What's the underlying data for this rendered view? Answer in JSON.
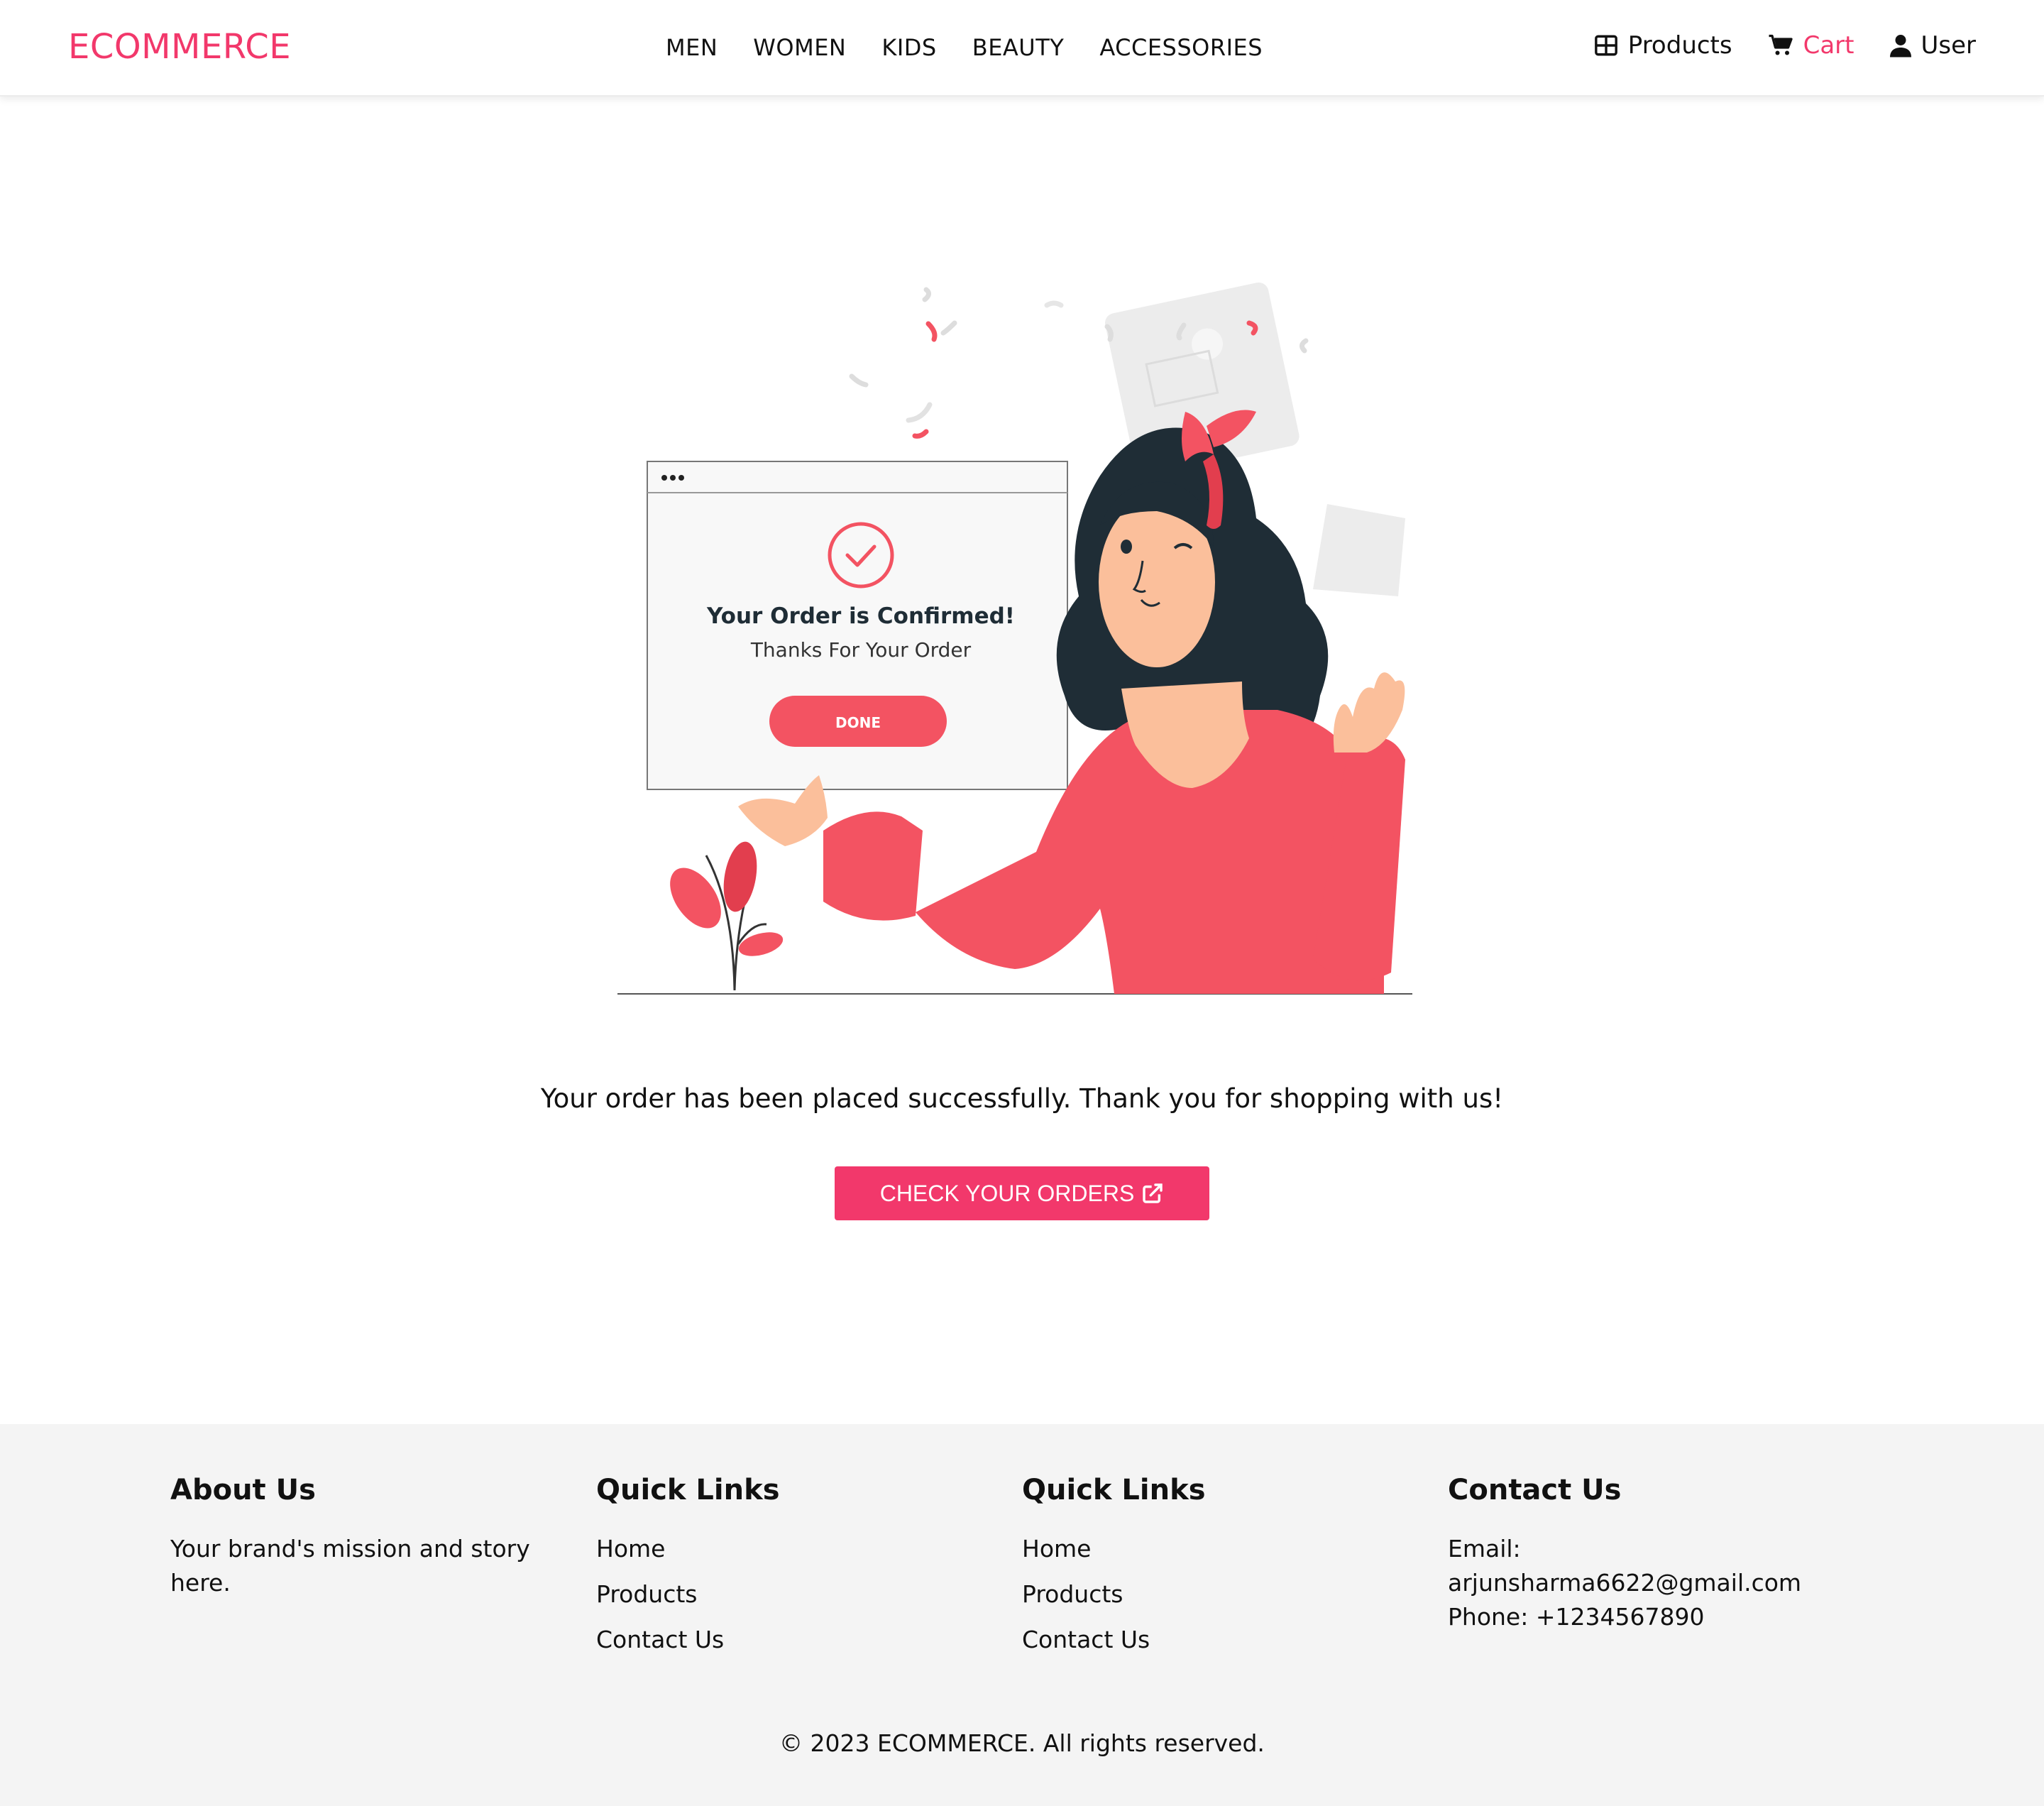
{
  "brand": "ECOMMERCE",
  "nav": {
    "categories": [
      "MEN",
      "WOMEN",
      "KIDS",
      "BEAUTY",
      "ACCESSORIES"
    ],
    "products_label": "Products",
    "cart_label": "Cart",
    "user_label": "User"
  },
  "illustration": {
    "card_title": "Your Order is Confirmed!",
    "card_subtitle": "Thanks For Your Order",
    "card_button": "DONE"
  },
  "main": {
    "success_message": "Your order has been placed successfully. Thank you for shopping with us!",
    "check_orders_label": "CHECK YOUR ORDERS"
  },
  "footer": {
    "about": {
      "heading": "About Us",
      "text": "Your brand's mission and story here."
    },
    "quick_links_1": {
      "heading": "Quick Links",
      "links": [
        "Home",
        "Products",
        "Contact Us"
      ]
    },
    "quick_links_2": {
      "heading": "Quick Links",
      "links": [
        "Home",
        "Products",
        "Contact Us"
      ]
    },
    "contact": {
      "heading": "Contact Us",
      "email_label": "Email:",
      "email": "arjunsharma6622@gmail.com",
      "phone": "Phone: +1234567890"
    },
    "copyright": "© 2023 ECOMMERCE. All rights reserved."
  },
  "colors": {
    "accent": "#f2386b",
    "illustration_red": "#f35362",
    "hair": "#1f2d36",
    "footer_bg": "#f4f4f4"
  },
  "icons": {
    "products": "grid-icon",
    "cart": "cart-icon",
    "user": "user-icon",
    "external": "external-link-icon"
  }
}
